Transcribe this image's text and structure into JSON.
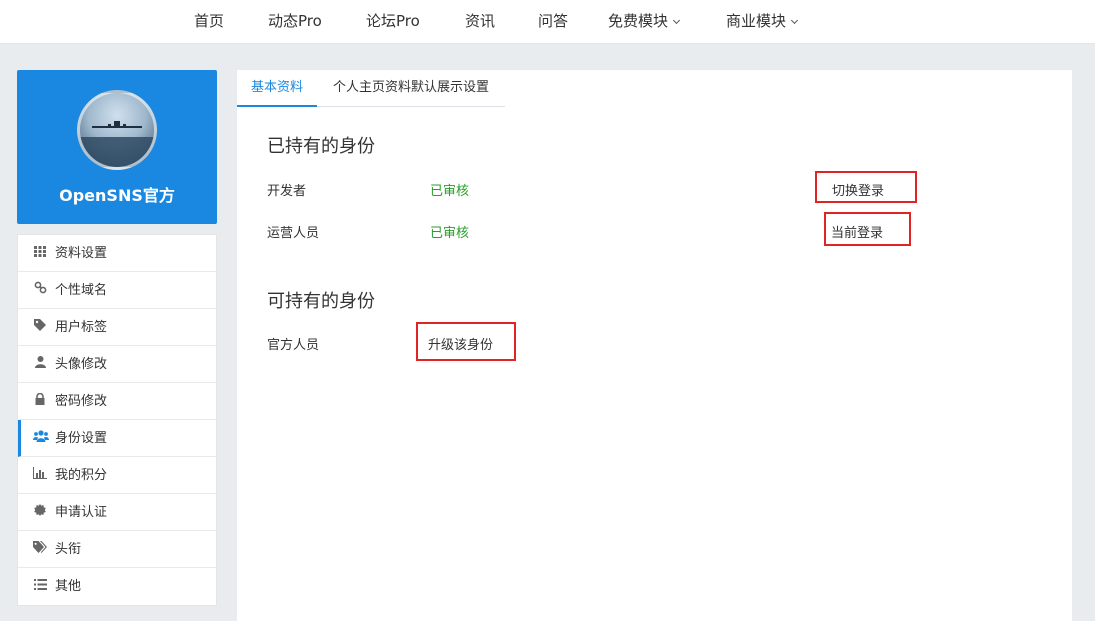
{
  "nav": {
    "items": [
      {
        "label": "首页"
      },
      {
        "label": "动态Pro"
      },
      {
        "label": "论坛Pro"
      },
      {
        "label": "资讯"
      },
      {
        "label": "问答"
      },
      {
        "label": "免费模块"
      },
      {
        "label": "商业模块"
      }
    ]
  },
  "profile": {
    "name": "OpenSNS官方"
  },
  "menu": {
    "items": [
      {
        "label": "资料设置",
        "icon": "grid-icon"
      },
      {
        "label": "个性域名",
        "icon": "link-icon"
      },
      {
        "label": "用户标签",
        "icon": "tag-icon"
      },
      {
        "label": "头像修改",
        "icon": "user-icon"
      },
      {
        "label": "密码修改",
        "icon": "lock-icon"
      },
      {
        "label": "身份设置",
        "icon": "users-icon"
      },
      {
        "label": "我的积分",
        "icon": "bar-chart-icon"
      },
      {
        "label": "申请认证",
        "icon": "certificate-icon"
      },
      {
        "label": "头衔",
        "icon": "tags-icon"
      },
      {
        "label": "其他",
        "icon": "list-icon"
      }
    ],
    "active_index": 5,
    "accent": "#1a88e0"
  },
  "tabs": [
    {
      "label": "基本资料"
    },
    {
      "label": "个人主页资料默认展示设置"
    }
  ],
  "owned": {
    "title": "已持有的身份",
    "rows": [
      {
        "name": "开发者",
        "status": "已审核",
        "action": "切换登录"
      },
      {
        "name": "运营人员",
        "status": "已审核",
        "action": "当前登录"
      }
    ]
  },
  "available": {
    "title": "可持有的身份",
    "rows": [
      {
        "name": "官方人员",
        "action": "升级该身份"
      }
    ]
  },
  "colors": {
    "status_green": "#2a9d2a",
    "highlight_red": "#e02424",
    "profile_blue": "#1a88e0"
  }
}
